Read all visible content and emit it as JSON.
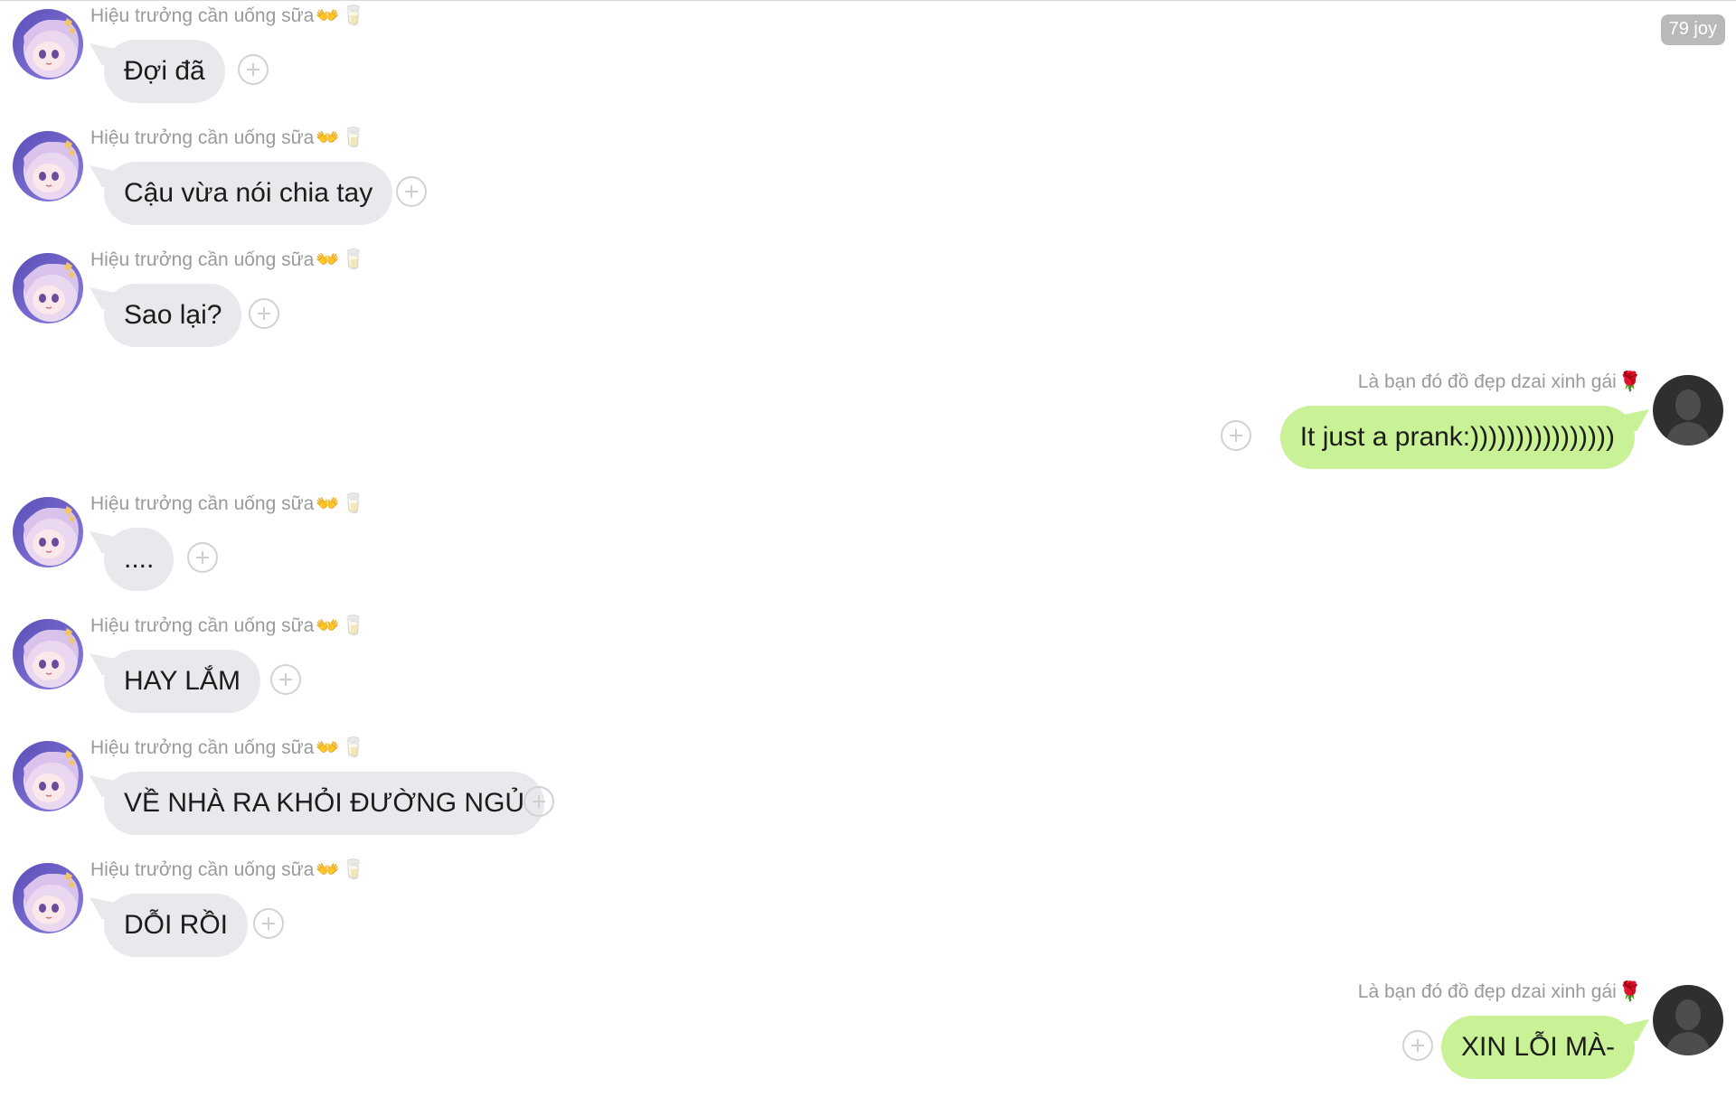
{
  "badge": "79 joy",
  "participants": {
    "other": {
      "name": "Hiệu trưởng cần uống sữa",
      "emojis": [
        "👐",
        "🥛"
      ]
    },
    "me": {
      "name": "Là bạn đó đồ đẹp dzai xinh gái",
      "emojis": [
        "🌹"
      ]
    }
  },
  "messages": [
    {
      "side": "left",
      "sender": "Hiệu trưởng cần uống sữa",
      "text": "Đợi đã"
    },
    {
      "side": "left",
      "sender": "Hiệu trưởng cần uống sữa",
      "text": "Cậu vừa nói chia tay"
    },
    {
      "side": "left",
      "sender": "Hiệu trưởng cần uống sữa",
      "text": "Sao lại?"
    },
    {
      "side": "right",
      "sender": "Là bạn đó đồ đẹp dzai xinh gái",
      "text": "It just a prank:))))))))))))))))"
    },
    {
      "side": "left",
      "sender": "Hiệu trưởng cần uống sữa",
      "text": "...."
    },
    {
      "side": "left",
      "sender": "Hiệu trưởng cần uống sữa",
      "text": "HAY LẮM"
    },
    {
      "side": "left",
      "sender": "Hiệu trưởng cần uống sữa",
      "text": "VỀ NHÀ RA KHỎI ĐƯỜNG NGỦ"
    },
    {
      "side": "left",
      "sender": "Hiệu trưởng cần uống sữa",
      "text": "DỖI RỒI"
    },
    {
      "side": "right",
      "sender": "Là bạn đó đồ đẹp dzai xinh gái",
      "text": "XIN LỖI MÀ-"
    }
  ],
  "icons": {
    "add_reaction": "plus-circle-icon",
    "avatar_other": "anime-girl-avatar",
    "avatar_me": "default-person-avatar"
  },
  "colors": {
    "bubble_incoming": "#e8e9ec",
    "bubble_outgoing": "#c9f195",
    "sender_text": "#9a9a9a",
    "badge_bg": "#b9b9b9"
  }
}
